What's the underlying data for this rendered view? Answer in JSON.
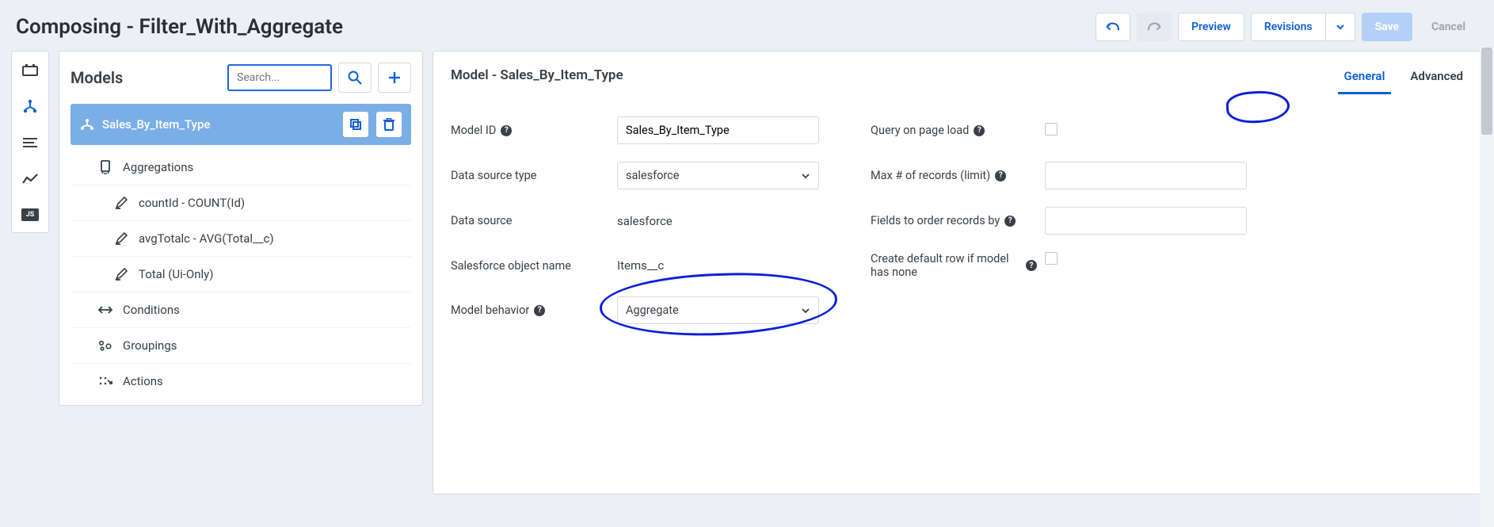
{
  "header": {
    "title": "Composing - Filter_With_Aggregate",
    "preview": "Preview",
    "revisions": "Revisions",
    "save": "Save",
    "cancel": "Cancel"
  },
  "leftPanel": {
    "title": "Models",
    "searchPlaceholder": "Search...",
    "model": {
      "name": "Sales_By_Item_Type"
    },
    "tree": {
      "aggregations": "Aggregations",
      "countId": "countId - COUNT(Id)",
      "avgTotalc": "avgTotalc - AVG(Total__c)",
      "totalUi": "Total (Ui-Only)",
      "conditions": "Conditions",
      "groupings": "Groupings",
      "actions": "Actions"
    }
  },
  "rightPanel": {
    "title": "Model - Sales_By_Item_Type",
    "tabs": {
      "general": "General",
      "advanced": "Advanced"
    },
    "labels": {
      "modelId": "Model ID",
      "dataSourceType": "Data source type",
      "dataSource": "Data source",
      "sfObjectName": "Salesforce object name",
      "modelBehavior": "Model behavior",
      "queryOnLoad": "Query on page load",
      "maxRecords": "Max # of records (limit)",
      "fieldsOrder": "Fields to order records by",
      "createDefault": "Create default row if model has none"
    },
    "values": {
      "modelId": "Sales_By_Item_Type",
      "dataSourceType": "salesforce",
      "dataSource": "salesforce",
      "sfObjectName": "Items__c",
      "modelBehavior": "Aggregate",
      "maxRecords": "",
      "fieldsOrder": ""
    }
  },
  "rail": {
    "js": "JS"
  }
}
